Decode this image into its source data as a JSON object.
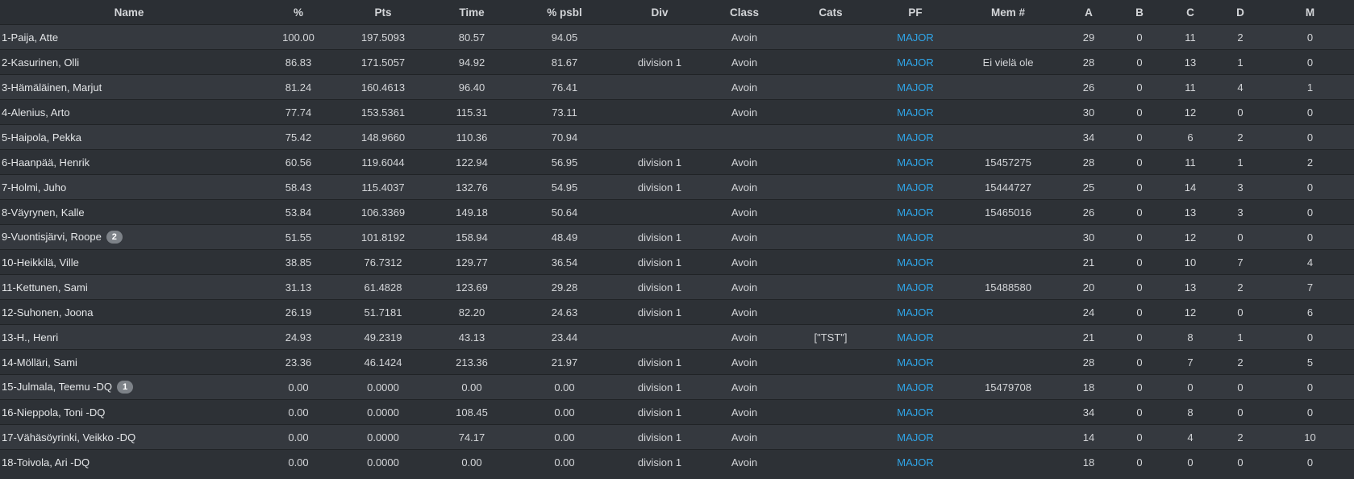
{
  "columns": [
    "Name",
    "%",
    "Pts",
    "Time",
    "% psbl",
    "Div",
    "Class",
    "Cats",
    "PF",
    "Mem #",
    "A",
    "B",
    "C",
    "D",
    "M"
  ],
  "rows": [
    {
      "name": "1-Paija, Atte",
      "badge": "",
      "pct": "100.00",
      "pts": "197.5093",
      "time": "80.57",
      "psbl": "94.05",
      "div": "",
      "cls": "Avoin",
      "cats": "",
      "pf": "MAJOR",
      "mem": "",
      "a": "29",
      "b": "0",
      "c": "11",
      "d": "2",
      "m": "0"
    },
    {
      "name": "2-Kasurinen, Olli",
      "badge": "",
      "pct": "86.83",
      "pts": "171.5057",
      "time": "94.92",
      "psbl": "81.67",
      "div": "division 1",
      "cls": "Avoin",
      "cats": "",
      "pf": "MAJOR",
      "mem": "Ei vielä ole",
      "a": "28",
      "b": "0",
      "c": "13",
      "d": "1",
      "m": "0"
    },
    {
      "name": "3-Hämäläinen, Marjut",
      "badge": "",
      "pct": "81.24",
      "pts": "160.4613",
      "time": "96.40",
      "psbl": "76.41",
      "div": "",
      "cls": "Avoin",
      "cats": "",
      "pf": "MAJOR",
      "mem": "",
      "a": "26",
      "b": "0",
      "c": "11",
      "d": "4",
      "m": "1"
    },
    {
      "name": "4-Alenius, Arto",
      "badge": "",
      "pct": "77.74",
      "pts": "153.5361",
      "time": "115.31",
      "psbl": "73.11",
      "div": "",
      "cls": "Avoin",
      "cats": "",
      "pf": "MAJOR",
      "mem": "",
      "a": "30",
      "b": "0",
      "c": "12",
      "d": "0",
      "m": "0"
    },
    {
      "name": "5-Haipola, Pekka",
      "badge": "",
      "pct": "75.42",
      "pts": "148.9660",
      "time": "110.36",
      "psbl": "70.94",
      "div": "",
      "cls": "",
      "cats": "",
      "pf": "MAJOR",
      "mem": "",
      "a": "34",
      "b": "0",
      "c": "6",
      "d": "2",
      "m": "0"
    },
    {
      "name": "6-Haanpää, Henrik",
      "badge": "",
      "pct": "60.56",
      "pts": "119.6044",
      "time": "122.94",
      "psbl": "56.95",
      "div": "division 1",
      "cls": "Avoin",
      "cats": "",
      "pf": "MAJOR",
      "mem": "15457275",
      "a": "28",
      "b": "0",
      "c": "11",
      "d": "1",
      "m": "2"
    },
    {
      "name": "7-Holmi, Juho",
      "badge": "",
      "pct": "58.43",
      "pts": "115.4037",
      "time": "132.76",
      "psbl": "54.95",
      "div": "division 1",
      "cls": "Avoin",
      "cats": "",
      "pf": "MAJOR",
      "mem": "15444727",
      "a": "25",
      "b": "0",
      "c": "14",
      "d": "3",
      "m": "0"
    },
    {
      "name": "8-Väyrynen, Kalle",
      "badge": "",
      "pct": "53.84",
      "pts": "106.3369",
      "time": "149.18",
      "psbl": "50.64",
      "div": "",
      "cls": "Avoin",
      "cats": "",
      "pf": "MAJOR",
      "mem": "15465016",
      "a": "26",
      "b": "0",
      "c": "13",
      "d": "3",
      "m": "0"
    },
    {
      "name": "9-Vuontisjärvi, Roope",
      "badge": "2",
      "pct": "51.55",
      "pts": "101.8192",
      "time": "158.94",
      "psbl": "48.49",
      "div": "division 1",
      "cls": "Avoin",
      "cats": "",
      "pf": "MAJOR",
      "mem": "",
      "a": "30",
      "b": "0",
      "c": "12",
      "d": "0",
      "m": "0"
    },
    {
      "name": "10-Heikkilä, Ville",
      "badge": "",
      "pct": "38.85",
      "pts": "76.7312",
      "time": "129.77",
      "psbl": "36.54",
      "div": "division 1",
      "cls": "Avoin",
      "cats": "",
      "pf": "MAJOR",
      "mem": "",
      "a": "21",
      "b": "0",
      "c": "10",
      "d": "7",
      "m": "4"
    },
    {
      "name": "11-Kettunen, Sami",
      "badge": "",
      "pct": "31.13",
      "pts": "61.4828",
      "time": "123.69",
      "psbl": "29.28",
      "div": "division 1",
      "cls": "Avoin",
      "cats": "",
      "pf": "MAJOR",
      "mem": "15488580",
      "a": "20",
      "b": "0",
      "c": "13",
      "d": "2",
      "m": "7"
    },
    {
      "name": "12-Suhonen, Joona",
      "badge": "",
      "pct": "26.19",
      "pts": "51.7181",
      "time": "82.20",
      "psbl": "24.63",
      "div": "division 1",
      "cls": "Avoin",
      "cats": "",
      "pf": "MAJOR",
      "mem": "",
      "a": "24",
      "b": "0",
      "c": "12",
      "d": "0",
      "m": "6"
    },
    {
      "name": "13-H., Henri",
      "badge": "",
      "pct": "24.93",
      "pts": "49.2319",
      "time": "43.13",
      "psbl": "23.44",
      "div": "",
      "cls": "Avoin",
      "cats": "[\"TST\"]",
      "pf": "MAJOR",
      "mem": "",
      "a": "21",
      "b": "0",
      "c": "8",
      "d": "1",
      "m": "0"
    },
    {
      "name": "14-Mölläri, Sami",
      "badge": "",
      "pct": "23.36",
      "pts": "46.1424",
      "time": "213.36",
      "psbl": "21.97",
      "div": "division 1",
      "cls": "Avoin",
      "cats": "",
      "pf": "MAJOR",
      "mem": "",
      "a": "28",
      "b": "0",
      "c": "7",
      "d": "2",
      "m": "5"
    },
    {
      "name": "15-Julmala, Teemu -DQ",
      "badge": "1",
      "pct": "0.00",
      "pts": "0.0000",
      "time": "0.00",
      "psbl": "0.00",
      "div": "division 1",
      "cls": "Avoin",
      "cats": "",
      "pf": "MAJOR",
      "mem": "15479708",
      "a": "18",
      "b": "0",
      "c": "0",
      "d": "0",
      "m": "0"
    },
    {
      "name": "16-Nieppola, Toni -DQ",
      "badge": "",
      "pct": "0.00",
      "pts": "0.0000",
      "time": "108.45",
      "psbl": "0.00",
      "div": "division 1",
      "cls": "Avoin",
      "cats": "",
      "pf": "MAJOR",
      "mem": "",
      "a": "34",
      "b": "0",
      "c": "8",
      "d": "0",
      "m": "0"
    },
    {
      "name": "17-Vähäsöyrinki, Veikko -DQ",
      "badge": "",
      "pct": "0.00",
      "pts": "0.0000",
      "time": "74.17",
      "psbl": "0.00",
      "div": "division 1",
      "cls": "Avoin",
      "cats": "",
      "pf": "MAJOR",
      "mem": "",
      "a": "14",
      "b": "0",
      "c": "4",
      "d": "2",
      "m": "10"
    },
    {
      "name": "18-Toivola, Ari -DQ",
      "badge": "",
      "pct": "0.00",
      "pts": "0.0000",
      "time": "0.00",
      "psbl": "0.00",
      "div": "division 1",
      "cls": "Avoin",
      "cats": "",
      "pf": "MAJOR",
      "mem": "",
      "a": "18",
      "b": "0",
      "c": "0",
      "d": "0",
      "m": "0"
    }
  ],
  "colors": {
    "accent_link": "#2fa4e7",
    "row_odd": "#35393f",
    "row_even": "#2d3136",
    "badge": "#7d8288"
  }
}
